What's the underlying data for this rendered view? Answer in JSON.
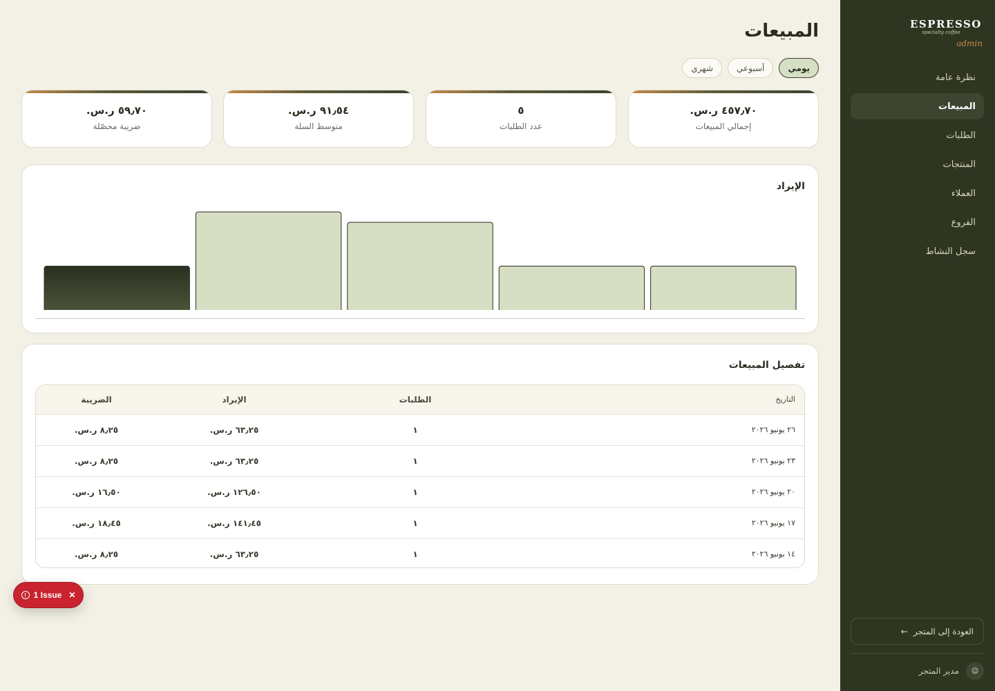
{
  "sidebar": {
    "brand": "ESPRESSO",
    "tagline": "specialty coffee",
    "role": "admin",
    "items": [
      {
        "label": "نظرة عامة",
        "active": false
      },
      {
        "label": "المبيعات",
        "active": true
      },
      {
        "label": "الطلبات",
        "active": false
      },
      {
        "label": "المنتجات",
        "active": false
      },
      {
        "label": "العملاء",
        "active": false
      },
      {
        "label": "الفروع",
        "active": false
      },
      {
        "label": "سجل النشاط",
        "active": false
      }
    ],
    "back_label": "العودة إلى المتجر",
    "back_icon": "←",
    "user_name": "مدير المتجر",
    "user_icon": "☺"
  },
  "page": {
    "title": "المبيعات",
    "periods": [
      {
        "label": "يومي",
        "active": true
      },
      {
        "label": "أسبوعي",
        "active": false
      },
      {
        "label": "شهري",
        "active": false
      }
    ]
  },
  "stats": [
    {
      "value": "٤٥٧٫٧٠ ر.س.",
      "label": "إجمالي المبيعات"
    },
    {
      "value": "٥",
      "label": "عدد الطلبات"
    },
    {
      "value": "٩١٫٥٤ ر.س.",
      "label": "متوسط السلة"
    },
    {
      "value": "٥٩٫٧٠ ر.س.",
      "label": "ضريبة محصّلة"
    }
  ],
  "revenue_panel": {
    "title": "الإيراد"
  },
  "chart_data": {
    "type": "bar",
    "categories": [
      "٢٦ يونيو ٢٠٢٦",
      "٢٣ يونيو ٢٠٢٦",
      "٢٠ يونيو ٢٠٢٦",
      "١٧ يونيو ٢٠٢٦",
      "١٤ يونيو ٢٠٢٦"
    ],
    "values": [
      63.25,
      63.25,
      126.5,
      141.45,
      63.25
    ],
    "order": "right-to-left",
    "highlighted_index": 4,
    "colors": {
      "bar": "#d6dec3",
      "highlight": "#2e3521",
      "stroke": "#2b2b22"
    },
    "ylim": [
      0,
      141.45
    ],
    "grid": false
  },
  "table": {
    "title": "تفصيل المبيعات",
    "headers": {
      "date": "التاريخ",
      "orders": "الطلبات",
      "revenue": "الإيراد",
      "tax": "الضريبة"
    },
    "rows": [
      {
        "date": "٢٦ يونيو ٢٠٢٦",
        "orders": "١",
        "revenue": "٦٣٫٢٥ ر.س.",
        "tax": "٨٫٢٥ ر.س."
      },
      {
        "date": "٢٣ يونيو ٢٠٢٦",
        "orders": "١",
        "revenue": "٦٣٫٢٥ ر.س.",
        "tax": "٨٫٢٥ ر.س."
      },
      {
        "date": "٢٠ يونيو ٢٠٢٦",
        "orders": "١",
        "revenue": "١٢٦٫٥٠ ر.س.",
        "tax": "١٦٫٥٠ ر.س."
      },
      {
        "date": "١٧ يونيو ٢٠٢٦",
        "orders": "١",
        "revenue": "١٤١٫٤٥ ر.س.",
        "tax": "١٨٫٤٥ ر.س."
      },
      {
        "date": "١٤ يونيو ٢٠٢٦",
        "orders": "١",
        "revenue": "٦٣٫٢٥ ر.س.",
        "tax": "٨٫٢٥ ر.س."
      }
    ]
  },
  "issue_badge": {
    "label": "1 Issue",
    "close": "✕",
    "icon": "!"
  },
  "colors": {
    "sidebar": "#2e3521",
    "background": "#f3f1e6",
    "accent": "#c68a4a",
    "issue": "#c8232f"
  }
}
